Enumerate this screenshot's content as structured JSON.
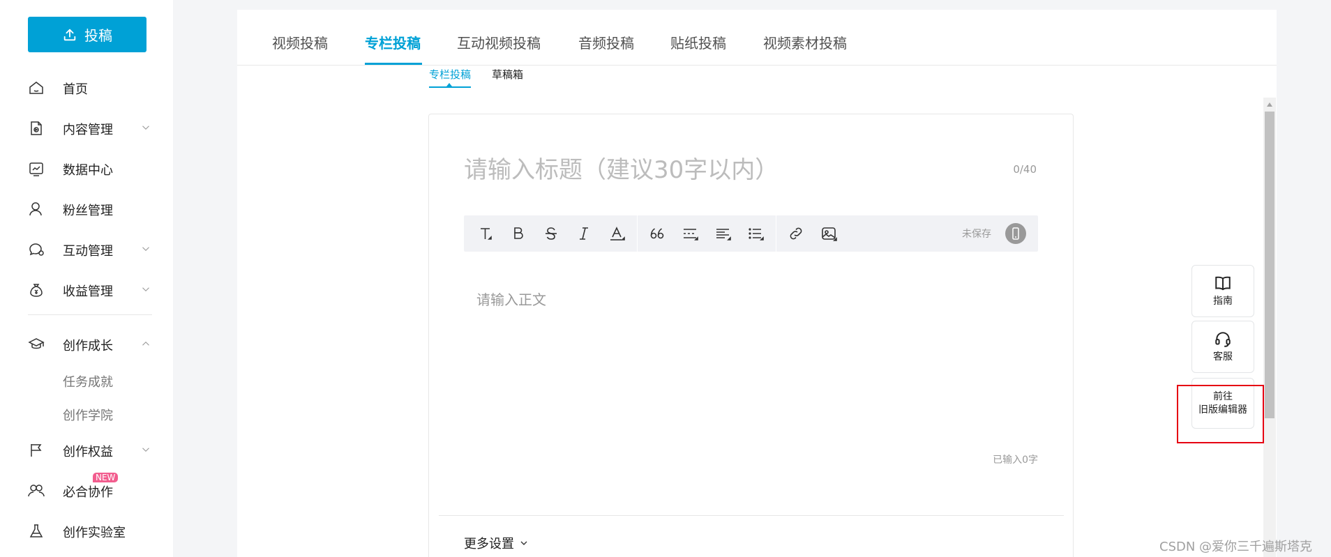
{
  "sidebar": {
    "upload_label": "投稿",
    "items": [
      {
        "label": "首页",
        "icon": "home-icon"
      },
      {
        "label": "内容管理",
        "icon": "content-icon"
      },
      {
        "label": "数据中心",
        "icon": "chart-icon"
      },
      {
        "label": "粉丝管理",
        "icon": "user-icon"
      },
      {
        "label": "互动管理",
        "icon": "chat-icon"
      },
      {
        "label": "收益管理",
        "icon": "money-bag-icon"
      },
      {
        "label": "创作成长",
        "icon": "graduation-cap-icon"
      },
      {
        "label": "创作权益",
        "icon": "flag-icon"
      },
      {
        "label": "必合协作",
        "icon": "people-icon"
      },
      {
        "label": "创作实验室",
        "icon": "flask-icon"
      }
    ],
    "sub_items": [
      "任务成就",
      "创作学院"
    ],
    "new_badge": "NEW"
  },
  "tabs": [
    "视频投稿",
    "专栏投稿",
    "互动视频投稿",
    "音频投稿",
    "贴纸投稿",
    "视频素材投稿"
  ],
  "active_tab": "专栏投稿",
  "subtabs": [
    "专栏投稿",
    "草稿箱"
  ],
  "editor": {
    "title_placeholder": "请输入标题（建议30字以内）",
    "title_count": "0/40",
    "unsaved": "未保存",
    "body_placeholder": "请输入正文",
    "word_count": "已输入0字",
    "more_settings": "更多设置"
  },
  "float_panel": {
    "guide": "指南",
    "service": "客服",
    "old_editor_line1": "前往",
    "old_editor_line2": "旧版编辑器"
  },
  "watermark": "CSDN @爱你三千遍斯塔克",
  "colors": {
    "accent": "#00a1d6",
    "badge": "#f25d8e",
    "highlight": "#e60012"
  }
}
